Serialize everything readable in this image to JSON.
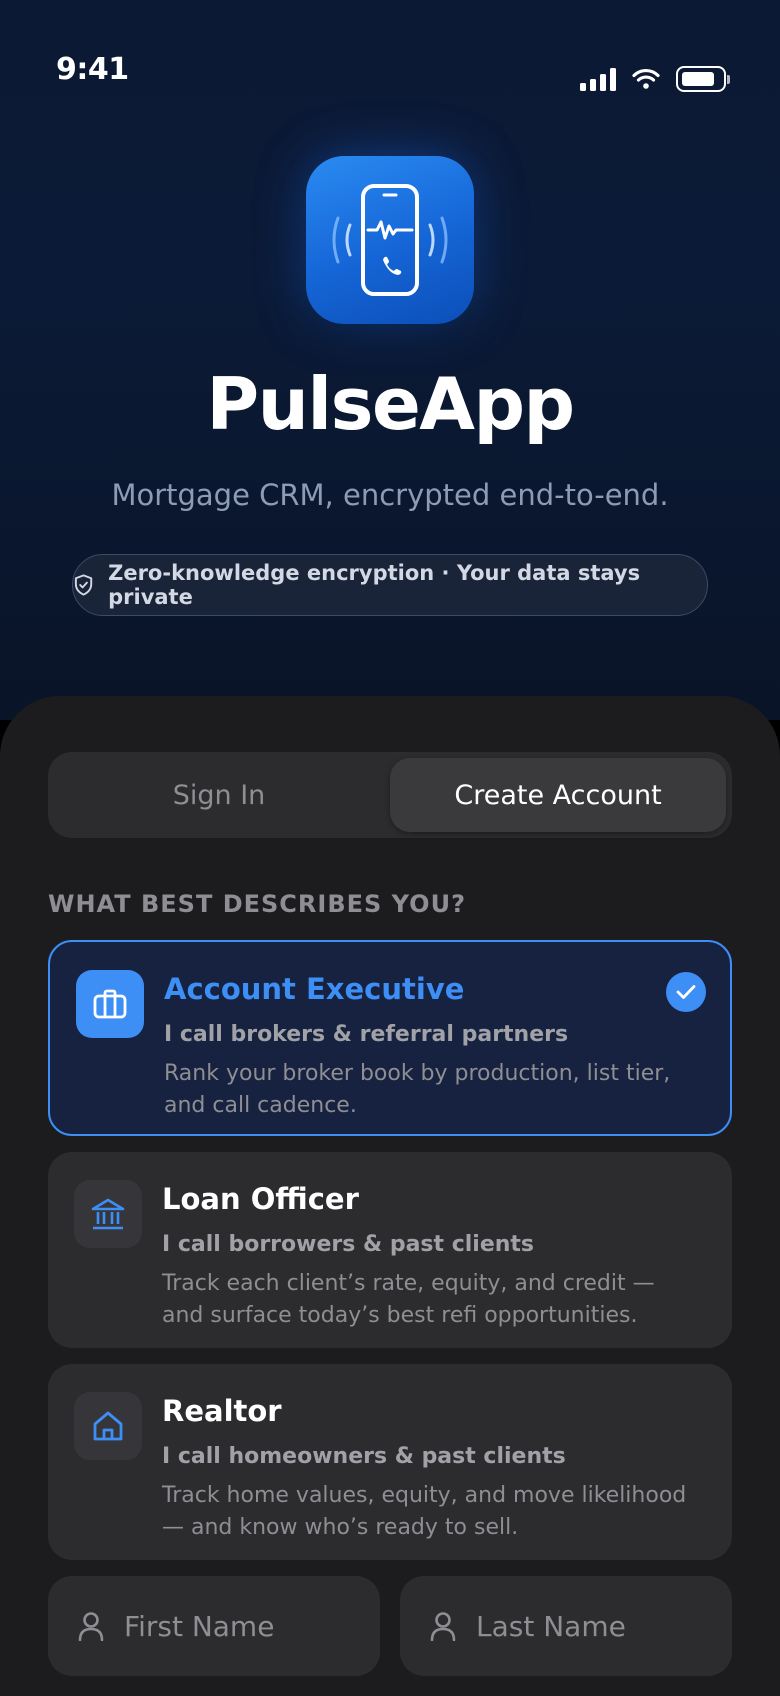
{
  "status_bar": {
    "time": "9:41"
  },
  "app": {
    "name": "PulseApp",
    "tagline": "Mortgage CRM, encrypted end-to-end.",
    "privacy_note": "Zero-knowledge encryption · Your data stays private"
  },
  "auth_tabs": {
    "sign_in": "Sign In",
    "create_account": "Create Account",
    "active": "create_account"
  },
  "role_section": {
    "label": "WHAT BEST DESCRIBES YOU?",
    "roles": [
      {
        "title": "Account Executive",
        "subtitle": "I call brokers & referral partners",
        "description": "Rank your broker book by production, list tier, and call cadence.",
        "icon": "briefcase-icon",
        "selected": true
      },
      {
        "title": "Loan Officer",
        "subtitle": "I call borrowers & past clients",
        "description": "Track each client’s rate, equity, and credit — and surface today’s best refi opportunities.",
        "icon": "bank-icon",
        "selected": false
      },
      {
        "title": "Realtor",
        "subtitle": "I call homeowners & past clients",
        "description": "Track home values, equity, and move likelihood — and know who’s ready to sell.",
        "icon": "house-icon",
        "selected": false
      }
    ]
  },
  "form": {
    "first_name": {
      "placeholder": "First Name",
      "value": ""
    },
    "last_name": {
      "placeholder": "Last Name",
      "value": ""
    }
  },
  "colors": {
    "accent": "#3d8ef5",
    "hero_bg": "#0b1a36",
    "sheet_bg": "#1c1c1e",
    "card_bg": "#2c2c2e",
    "selected_card_bg": "#16223f"
  }
}
